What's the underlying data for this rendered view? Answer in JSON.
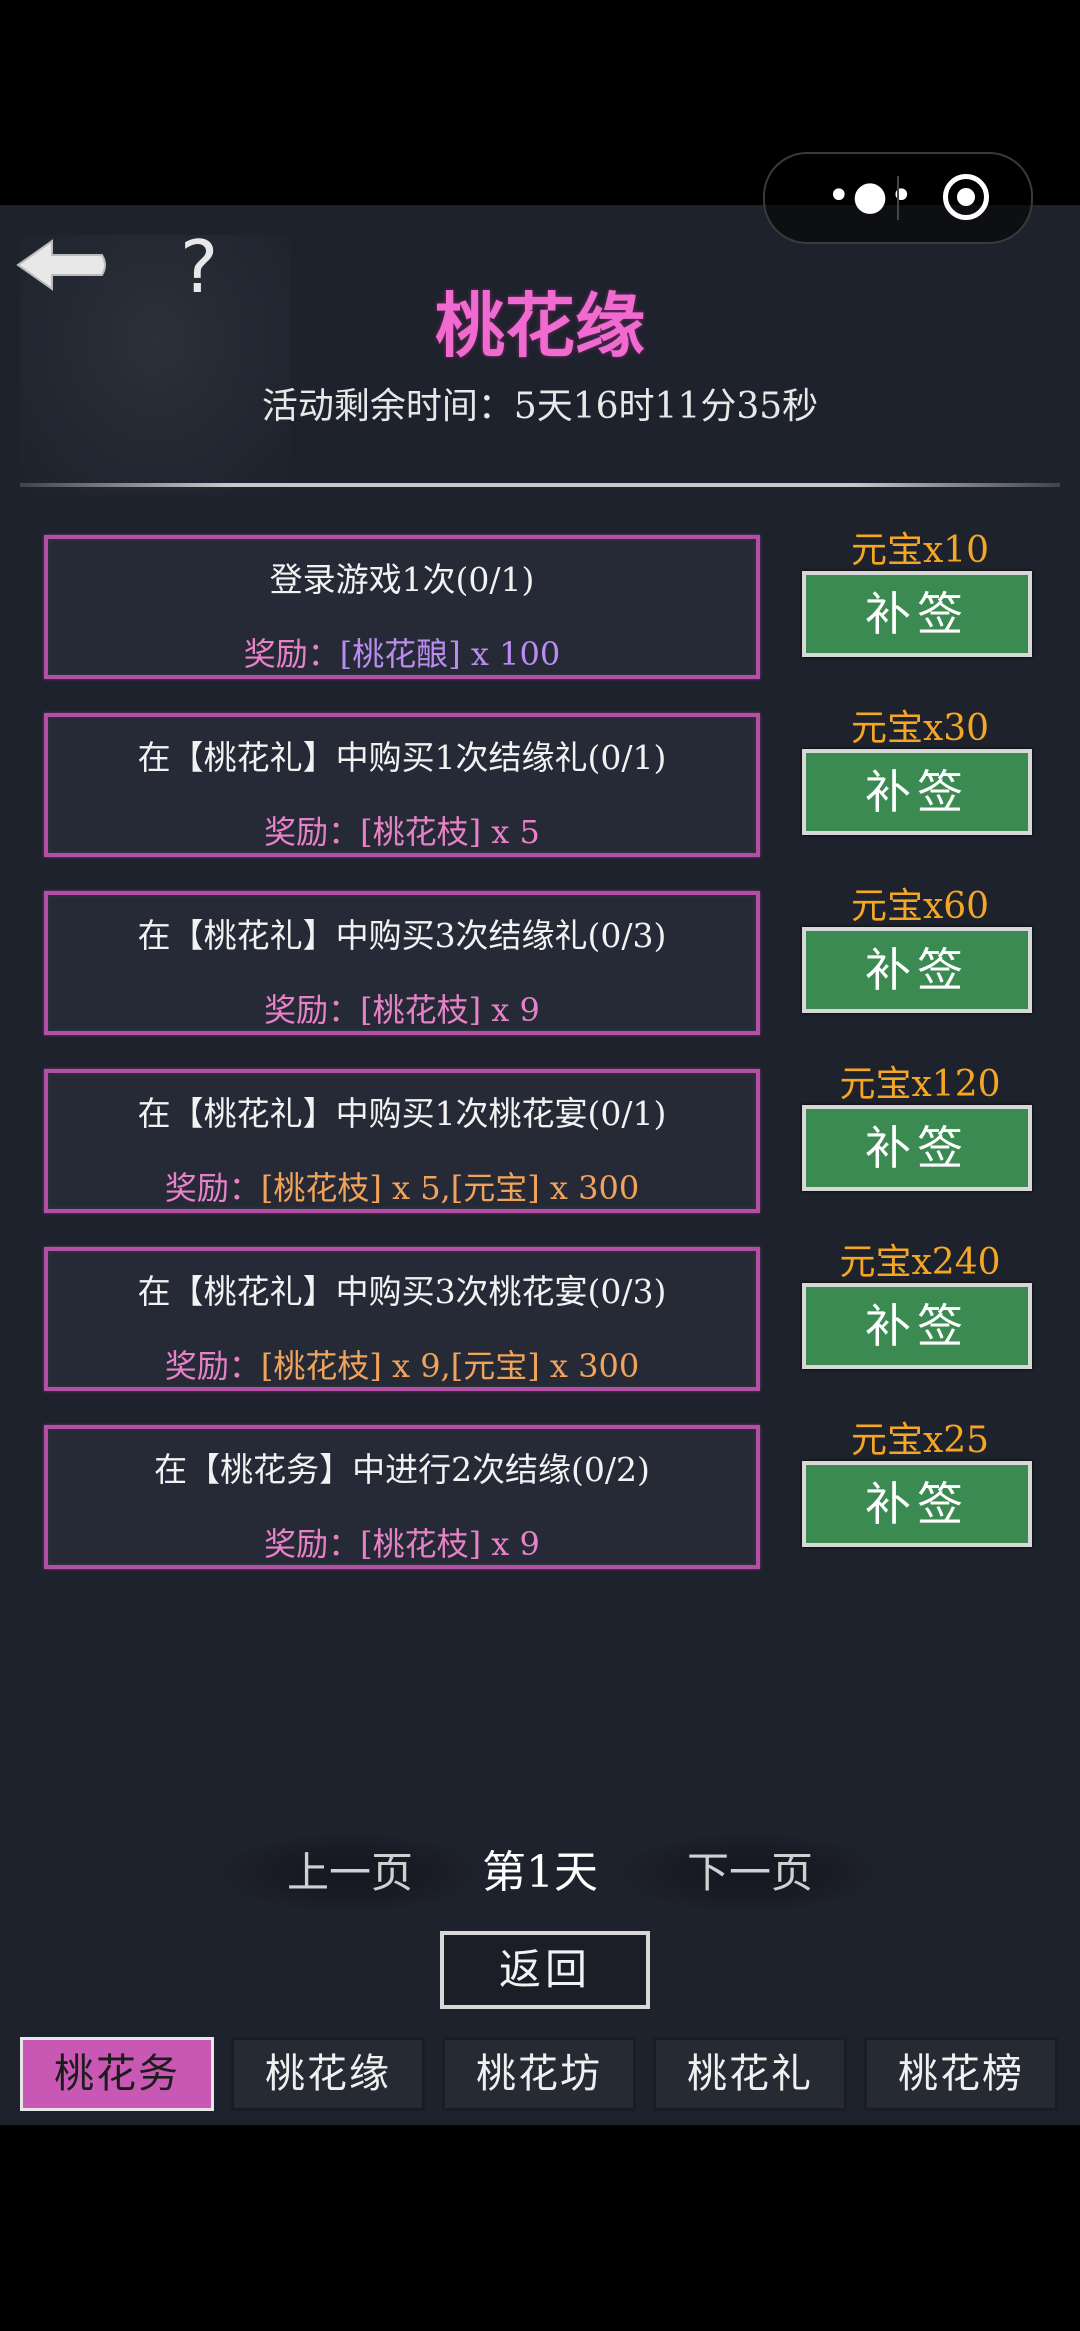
{
  "title": "桃花缘",
  "timer": "活动剩余时间：5天16时11分35秒",
  "tasks": [
    {
      "desc": "登录游戏1次(0/1)",
      "reward_prefix": "奖励：",
      "items": [
        {
          "text": "[桃花酿] x 100",
          "color": "#b98cf0"
        }
      ],
      "cost": "元宝x10",
      "button": "补签"
    },
    {
      "desc": "在【桃花礼】中购买1次结缘礼(0/1)",
      "reward_prefix": "奖励：",
      "items": [
        {
          "text": "[桃花枝] x 5",
          "color": "#e882c8"
        }
      ],
      "cost": "元宝x30",
      "button": "补签"
    },
    {
      "desc": "在【桃花礼】中购买3次结缘礼(0/3)",
      "reward_prefix": "奖励：",
      "items": [
        {
          "text": "[桃花枝] x 9",
          "color": "#e882c8"
        }
      ],
      "cost": "元宝x60",
      "button": "补签"
    },
    {
      "desc": "在【桃花礼】中购买1次桃花宴(0/1)",
      "reward_prefix": "奖励：",
      "items": [
        {
          "text": "[桃花枝] x 5,",
          "color": "#f0a35a"
        },
        {
          "text": "[元宝] x 300",
          "color": "#f0a35a"
        }
      ],
      "cost": "元宝x120",
      "button": "补签"
    },
    {
      "desc": "在【桃花礼】中购买3次桃花宴(0/3)",
      "reward_prefix": "奖励：",
      "items": [
        {
          "text": "[桃花枝] x 9,",
          "color": "#f0a35a"
        },
        {
          "text": "[元宝] x 300",
          "color": "#f0a35a"
        }
      ],
      "cost": "元宝x240",
      "button": "补签"
    },
    {
      "desc": "在【桃花务】中进行2次结缘(0/2)",
      "reward_prefix": "奖励：",
      "items": [
        {
          "text": "[桃花枝] x 9",
          "color": "#e882c8"
        }
      ],
      "cost": "元宝x25",
      "button": "补签"
    }
  ],
  "pager": {
    "prev": "上一页",
    "day": "第1天",
    "next": "下一页"
  },
  "return": "返回",
  "tabs": [
    {
      "label": "桃花务",
      "active": true
    },
    {
      "label": "桃花缘",
      "active": false
    },
    {
      "label": "桃花坊",
      "active": false
    },
    {
      "label": "桃花礼",
      "active": false
    },
    {
      "label": "桃花榜",
      "active": false
    }
  ],
  "colors": {
    "title": "#f06ad0",
    "button_green": "#3b8a52",
    "cost": "#f5a623",
    "tab_active": "#c858b4",
    "frame": "#b44fa6"
  },
  "icons": {
    "back": "back-arrow-icon",
    "help": "question-mark-icon",
    "menu": "more-dots-icon",
    "close": "target-circle-icon"
  }
}
